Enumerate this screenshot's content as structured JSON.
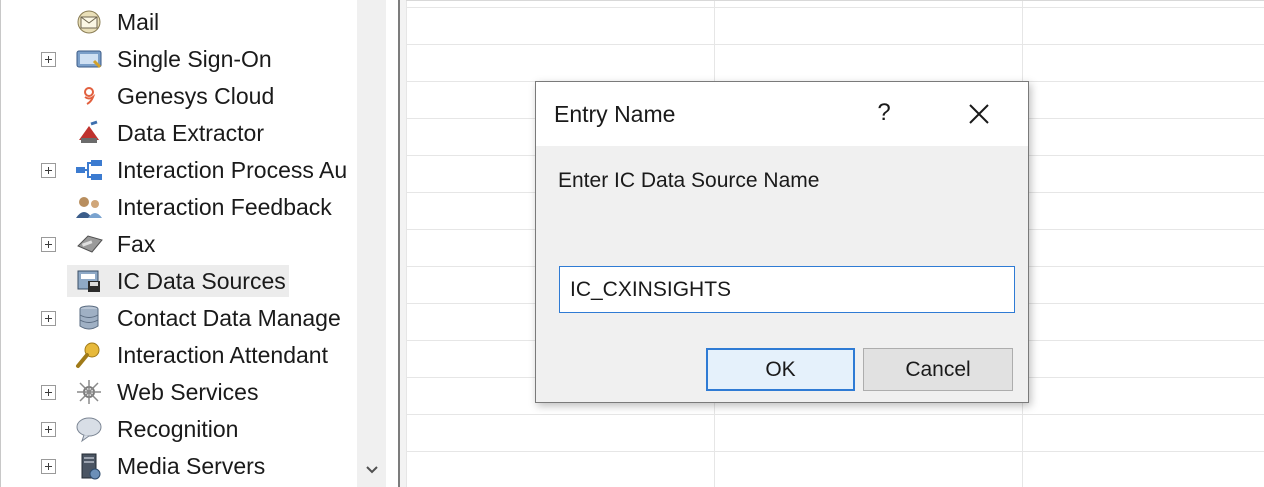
{
  "tree": {
    "items": [
      {
        "label": "Mail",
        "icon": "mail-icon",
        "expandable": false,
        "selected": false
      },
      {
        "label": "Single Sign-On",
        "icon": "single-sign-on-icon",
        "expandable": true,
        "selected": false
      },
      {
        "label": "Genesys Cloud",
        "icon": "genesys-cloud-icon",
        "expandable": false,
        "selected": false
      },
      {
        "label": "Data Extractor",
        "icon": "data-extractor-icon",
        "expandable": false,
        "selected": false
      },
      {
        "label": "Interaction Process Au",
        "icon": "process-automation-icon",
        "expandable": true,
        "selected": false
      },
      {
        "label": "Interaction Feedback",
        "icon": "feedback-icon",
        "expandable": false,
        "selected": false
      },
      {
        "label": "Fax",
        "icon": "fax-icon",
        "expandable": true,
        "selected": false
      },
      {
        "label": "IC Data Sources",
        "icon": "data-sources-icon",
        "expandable": false,
        "selected": true
      },
      {
        "label": "Contact Data Manage",
        "icon": "contact-data-icon",
        "expandable": true,
        "selected": false
      },
      {
        "label": "Interaction Attendant",
        "icon": "attendant-icon",
        "expandable": false,
        "selected": false
      },
      {
        "label": "Web Services",
        "icon": "web-services-icon",
        "expandable": true,
        "selected": false
      },
      {
        "label": "Recognition",
        "icon": "recognition-icon",
        "expandable": true,
        "selected": false
      },
      {
        "label": "Media Servers",
        "icon": "media-servers-icon",
        "expandable": true,
        "selected": false
      }
    ]
  },
  "dialog": {
    "title": "Entry Name",
    "help_label": "?",
    "prompt": "Enter IC Data Source Name",
    "input_value": "IC_CXINSIGHTS",
    "ok_label": "OK",
    "cancel_label": "Cancel"
  },
  "colors": {
    "accent_border": "#2f7bd4",
    "dialog_background": "#f0f0f0",
    "selection_background": "#ececec"
  }
}
